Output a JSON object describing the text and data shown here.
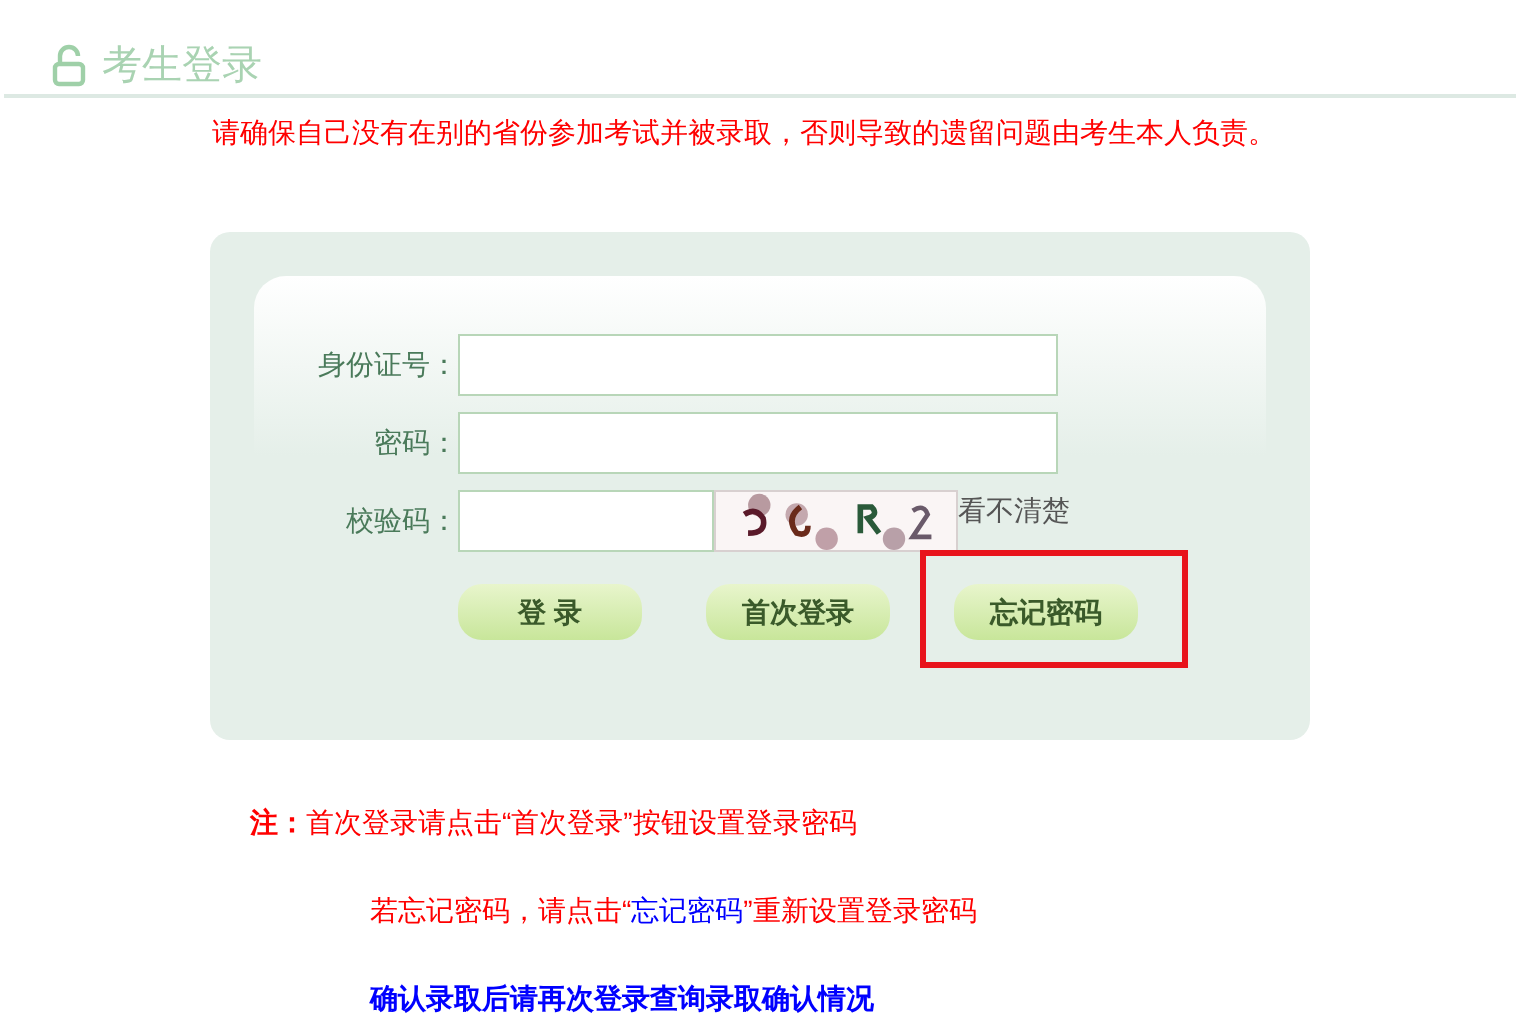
{
  "header": {
    "title": "考生登录"
  },
  "warning": "请确保自己没有在别的省份参加考试并被录取，否则导致的遗留问题由考生本人负责。",
  "form": {
    "fields": [
      {
        "kind": "text",
        "label": "身份证号："
      },
      {
        "kind": "password",
        "label": "密码："
      },
      {
        "kind": "captcha",
        "label": "校验码：",
        "refresh": "看不清楚"
      }
    ],
    "buttons": [
      {
        "label": "登 录",
        "highlighted": false
      },
      {
        "label": "首次登录",
        "highlighted": false
      },
      {
        "label": "忘记密码",
        "highlighted": true
      }
    ]
  },
  "notes": [
    {
      "segments": [
        {
          "text": "**注：**首次登录请点击“首次登录”按钮设置登录密码",
          "color": "#ff0000"
        }
      ]
    },
    {
      "segments": [
        {
          "text": "若忘记密码，请点击“",
          "color": "#ff0000"
        },
        {
          "text": "忘记密码",
          "color": "#0000ff"
        },
        {
          "text": "”重新设置登录密码",
          "color": "#ff0000"
        }
      ]
    },
    {
      "segments": [
        {
          "text": "**确认录取后请再次登录查询录取确认情况**",
          "color": "#0000ff"
        }
      ]
    }
  ]
}
